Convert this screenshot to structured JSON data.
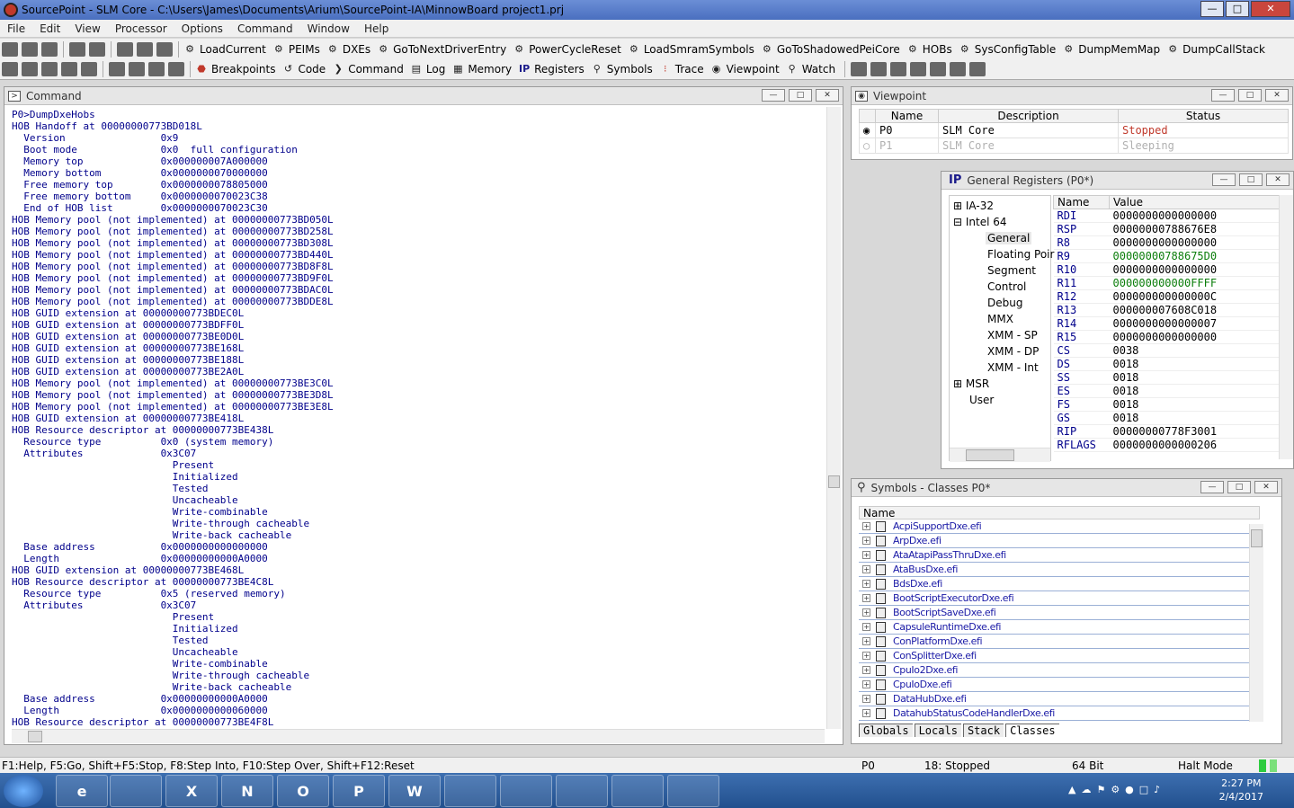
{
  "window": {
    "title": "SourcePoint - SLM Core - C:\\Users\\James\\Documents\\Arium\\SourcePoint-IA\\MinnowBoard project1.prj"
  },
  "menu": [
    "File",
    "Edit",
    "View",
    "Processor",
    "Options",
    "Command",
    "Window",
    "Help"
  ],
  "toolbar1": [
    "LoadCurrent",
    "PEIMs",
    "DXEs",
    "GoToNextDriverEntry",
    "PowerCycleReset",
    "LoadSmramSymbols",
    "GoToShadowedPeiCore",
    "HOBs",
    "SysConfigTable",
    "DumpMemMap",
    "DumpCallStack"
  ],
  "toolbar2": [
    "Breakpoints",
    "Code",
    "Command",
    "Log",
    "Memory",
    "Registers",
    "Symbols",
    "Trace",
    "Viewpoint",
    "Watch"
  ],
  "command_pane": {
    "title": "Command",
    "lines": [
      "P0>DumpDxeHobs",
      "HOB Handoff at 00000000773BD018L",
      "  Version                0x9",
      "  Boot mode              0x0  full configuration",
      "  Memory top             0x000000007A000000",
      "  Memory bottom          0x0000000070000000",
      "  Free memory top        0x0000000078805000",
      "  Free memory bottom     0x0000000070023C38",
      "  End of HOB list        0x0000000070023C30",
      "HOB Memory pool (not implemented) at 00000000773BD050L",
      "HOB Memory pool (not implemented) at 00000000773BD258L",
      "HOB Memory pool (not implemented) at 00000000773BD308L",
      "HOB Memory pool (not implemented) at 00000000773BD440L",
      "HOB Memory pool (not implemented) at 00000000773BD8F8L",
      "HOB Memory pool (not implemented) at 00000000773BD9F0L",
      "HOB Memory pool (not implemented) at 00000000773BDAC0L",
      "HOB Memory pool (not implemented) at 00000000773BDDE8L",
      "HOB GUID extension at 00000000773BDEC0L",
      "HOB GUID extension at 00000000773BDFF0L",
      "HOB GUID extension at 00000000773BE0D0L",
      "HOB GUID extension at 00000000773BE168L",
      "HOB GUID extension at 00000000773BE188L",
      "HOB GUID extension at 00000000773BE2A0L",
      "HOB Memory pool (not implemented) at 00000000773BE3C0L",
      "HOB Memory pool (not implemented) at 00000000773BE3D8L",
      "HOB Memory pool (not implemented) at 00000000773BE3E8L",
      "HOB GUID extension at 00000000773BE418L",
      "HOB Resource descriptor at 00000000773BE438L",
      "  Resource type          0x0 (system memory)",
      "  Attributes             0x3C07",
      "                           Present",
      "                           Initialized",
      "                           Tested",
      "                           Uncacheable",
      "                           Write-combinable",
      "                           Write-through cacheable",
      "                           Write-back cacheable",
      "  Base address           0x0000000000000000",
      "  Length                 0x00000000000A0000",
      "HOB GUID extension at 00000000773BE468L",
      "HOB Resource descriptor at 00000000773BE4C8L",
      "  Resource type          0x5 (reserved memory)",
      "  Attributes             0x3C07",
      "                           Present",
      "                           Initialized",
      "                           Tested",
      "                           Uncacheable",
      "                           Write-combinable",
      "                           Write-through cacheable",
      "                           Write-back cacheable",
      "  Base address           0x00000000000A0000",
      "  Length                 0x0000000000060000",
      "HOB Resource descriptor at 00000000773BE4F8L"
    ]
  },
  "viewpoint_pane": {
    "title": "Viewpoint",
    "headers": [
      "Name",
      "Description",
      "Status"
    ],
    "rows": [
      {
        "name": "P0",
        "description": "SLM Core",
        "status": "Stopped"
      },
      {
        "name": "P1",
        "description": "SLM Core",
        "status": "Sleeping"
      }
    ]
  },
  "registers_pane": {
    "title": "General Registers (P0*)",
    "tree": [
      "IA-32",
      "Intel 64",
      "General",
      "Floating Poir",
      "Segment",
      "Control",
      "Debug",
      "MMX",
      "XMM - SP",
      "XMM - DP",
      "XMM - Int",
      "MSR",
      "User"
    ],
    "headers": [
      "Name",
      "Value"
    ],
    "rows": [
      {
        "name": "RDI",
        "value": "0000000000000000"
      },
      {
        "name": "RSP",
        "value": "00000000788676E8"
      },
      {
        "name": "R8",
        "value": "0000000000000000"
      },
      {
        "name": "R9",
        "value": "00000000788675D0"
      },
      {
        "name": "R10",
        "value": "0000000000000000"
      },
      {
        "name": "R11",
        "value": "000000000000FFFF"
      },
      {
        "name": "R12",
        "value": "000000000000000C"
      },
      {
        "name": "R13",
        "value": "000000007608C018"
      },
      {
        "name": "R14",
        "value": "0000000000000007"
      },
      {
        "name": "R15",
        "value": "0000000000000000"
      },
      {
        "name": "CS",
        "value": "0038"
      },
      {
        "name": "DS",
        "value": "0018"
      },
      {
        "name": "SS",
        "value": "0018"
      },
      {
        "name": "ES",
        "value": "0018"
      },
      {
        "name": "FS",
        "value": "0018"
      },
      {
        "name": "GS",
        "value": "0018"
      },
      {
        "name": "RIP",
        "value": "00000000778F3001"
      },
      {
        "name": "RFLAGS",
        "value": "0000000000000206"
      }
    ]
  },
  "symbols_pane": {
    "title": "Symbols - Classes P0*",
    "header": "Name",
    "items": [
      "AcpiSupportDxe.efi",
      "ArpDxe.efi",
      "AtaAtapiPassThruDxe.efi",
      "AtaBusDxe.efi",
      "BdsDxe.efi",
      "BootScriptExecutorDxe.efi",
      "BootScriptSaveDxe.efi",
      "CapsuleRuntimeDxe.efi",
      "ConPlatformDxe.efi",
      "ConSplitterDxe.efi",
      "CpuIo2Dxe.efi",
      "CpuIoDxe.efi",
      "DataHubDxe.efi",
      "DatahubStatusCodeHandlerDxe.efi"
    ],
    "tabs": [
      "Globals",
      "Locals",
      "Stack",
      "Classes"
    ]
  },
  "statusbar": {
    "hints": "F1:Help, F5:Go, Shift+F5:Stop, F8:Step Into, F10:Step Over, Shift+F12:Reset",
    "proc": "P0",
    "state": "18: Stopped",
    "mode": "64 Bit",
    "halt": "Halt Mode"
  },
  "taskbar": {
    "time": "2:27 PM",
    "date": "2/4/2017",
    "apps": [
      "e",
      "X",
      "N",
      "O",
      "P",
      "W",
      "",
      "",
      "",
      "",
      ""
    ]
  },
  "colors": {
    "changed_register": "#0a7d0a",
    "stopped": "#c0392b",
    "command_text": "#00008b"
  }
}
